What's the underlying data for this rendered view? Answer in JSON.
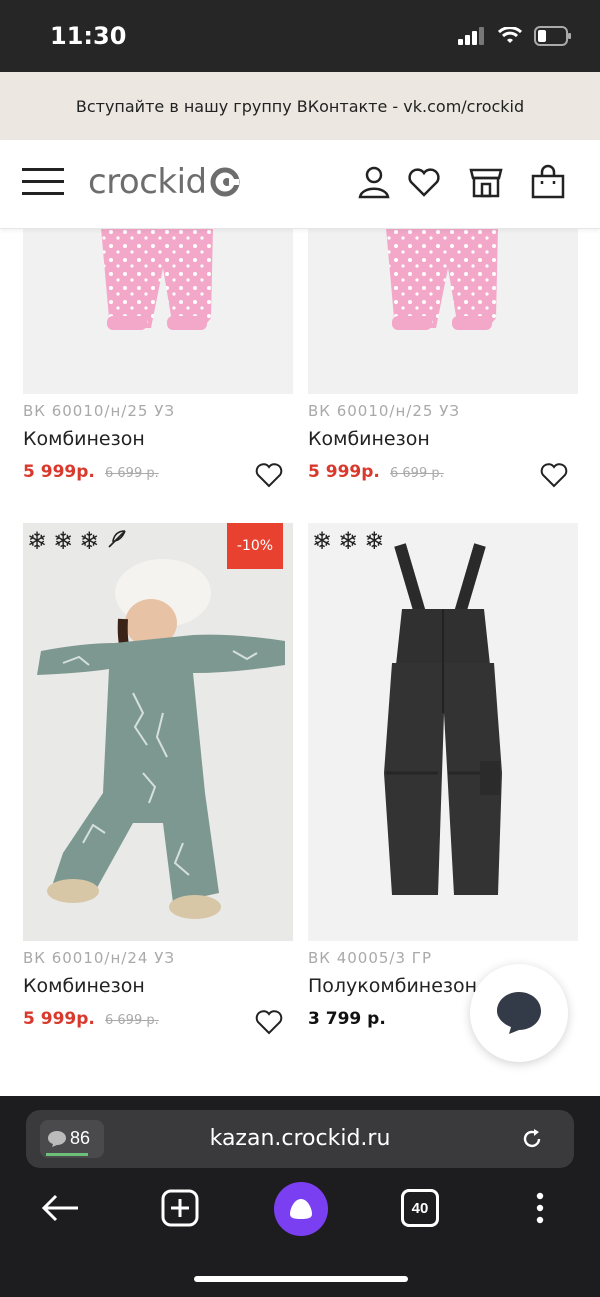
{
  "status_bar": {
    "time": "11:30"
  },
  "banner": {
    "text": "Вступайте в нашу группу ВКонтакте - vk.com/crockid"
  },
  "header": {
    "logo": "crockid"
  },
  "products": [
    {
      "sku": "ВК 60010/н/25 УЗ",
      "name": "Комбинезон",
      "price": "5 999р.",
      "old_price": "6 699 р."
    },
    {
      "sku": "ВК 60010/н/25 УЗ",
      "name": "Комбинезон",
      "price": "5 999р.",
      "old_price": "6 699 р."
    },
    {
      "sku": "ВК 60010/н/24 УЗ",
      "name": "Комбинезон",
      "price": "5 999р.",
      "old_price": "6 699 р.",
      "badge": "-10%"
    },
    {
      "sku": "ВК 40005/3 ГР",
      "name": "Полукомбинезон",
      "price": "3 799 р."
    }
  ],
  "browser": {
    "url": "kazan.crockid.ru",
    "comments": "86",
    "tabs": "40"
  },
  "colors": {
    "accent_red": "#d9392c",
    "badge_red": "#e8412f",
    "alice_purple": "#7b3ff2"
  }
}
